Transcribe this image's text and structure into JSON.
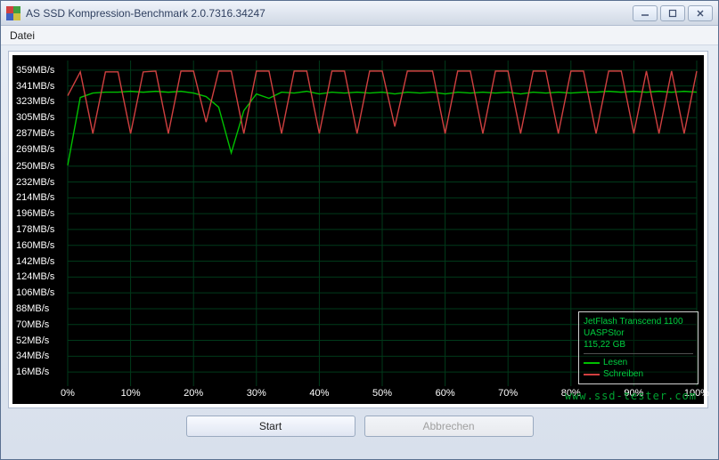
{
  "window": {
    "title": "AS SSD Kompression-Benchmark 2.0.7316.34247"
  },
  "menu": {
    "datei": "Datei"
  },
  "buttons": {
    "start": "Start",
    "abort": "Abbrechen"
  },
  "legend": {
    "device": "JetFlash Transcend 1100",
    "controller": "UASPStor",
    "capacity": "115,22 GB",
    "read_label": "Lesen",
    "write_label": "Schreiben"
  },
  "watermark": "www.ssd-tester.com",
  "chart_data": {
    "type": "line",
    "xlabel": "",
    "ylabel": "",
    "x_unit": "%",
    "y_unit": "MB/s",
    "xlim": [
      0,
      100
    ],
    "ylim": [
      0,
      370
    ],
    "y_ticks": [
      16,
      34,
      52,
      70,
      88,
      106,
      124,
      142,
      160,
      178,
      196,
      214,
      232,
      250,
      269,
      287,
      305,
      323,
      341,
      359
    ],
    "x_ticks": [
      0,
      10,
      20,
      30,
      40,
      50,
      60,
      70,
      80,
      90,
      100
    ],
    "categories_pct": [
      0,
      2,
      4,
      6,
      8,
      10,
      12,
      14,
      16,
      18,
      20,
      22,
      24,
      26,
      28,
      30,
      32,
      34,
      36,
      38,
      40,
      42,
      44,
      46,
      48,
      50,
      52,
      54,
      56,
      58,
      60,
      62,
      64,
      66,
      68,
      70,
      72,
      74,
      76,
      78,
      80,
      82,
      84,
      86,
      88,
      90,
      92,
      94,
      96,
      98,
      100
    ],
    "series": [
      {
        "name": "Lesen",
        "color": "#00c000",
        "values": [
          251,
          328,
          333,
          334,
          334,
          335,
          334,
          335,
          334,
          335,
          333,
          329,
          317,
          265,
          313,
          332,
          327,
          334,
          333,
          335,
          332,
          334,
          333,
          334,
          333,
          334,
          332,
          334,
          333,
          334,
          332,
          334,
          333,
          334,
          333,
          334,
          332,
          334,
          333,
          334,
          333,
          334,
          334,
          335,
          334,
          335,
          334,
          335,
          334,
          335,
          334
        ]
      },
      {
        "name": "Schreiben",
        "color": "#d04040",
        "values": [
          330,
          357,
          287,
          357,
          357,
          287,
          357,
          358,
          287,
          358,
          358,
          300,
          358,
          358,
          287,
          358,
          358,
          287,
          358,
          358,
          287,
          358,
          358,
          287,
          358,
          358,
          295,
          358,
          358,
          358,
          287,
          358,
          358,
          287,
          358,
          358,
          287,
          358,
          358,
          287,
          358,
          358,
          287,
          358,
          358,
          287,
          358,
          287,
          358,
          287,
          358
        ]
      }
    ]
  }
}
